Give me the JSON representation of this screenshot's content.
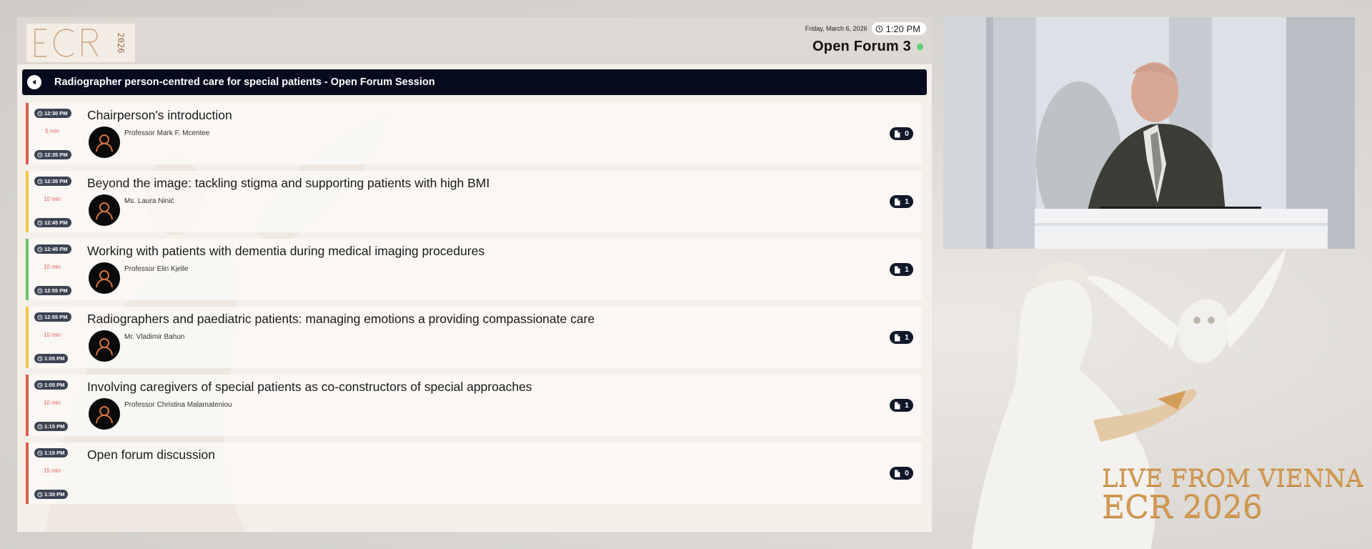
{
  "header": {
    "logo_text": "ECR 2026",
    "date": "Friday, March 6, 2026",
    "time": "1:20 PM",
    "room": "Open Forum 3"
  },
  "session": {
    "title": "Radiographer person-centred care for special patients - Open Forum Session"
  },
  "talks": [
    {
      "start": "12:30 PM",
      "duration": "5 min",
      "end": "12:35 PM",
      "title": "Chairperson's introduction",
      "speaker": "Professor Mark F. Mcentee",
      "docs": "0",
      "accent": "#e05a4f",
      "has_speaker": true
    },
    {
      "start": "12:35 PM",
      "duration": "10 min",
      "end": "12:45 PM",
      "title": "Beyond the image: tackling stigma and supporting patients with high BMI",
      "speaker": "Ms. Laura Ninić",
      "docs": "1",
      "accent": "#f1c644",
      "has_speaker": true
    },
    {
      "start": "12:45 PM",
      "duration": "10 min",
      "end": "12:55 PM",
      "title": "Working with patients with dementia during medical imaging procedures",
      "speaker": "Professor Elin Kjelle",
      "docs": "1",
      "accent": "#6cc36c",
      "has_speaker": true
    },
    {
      "start": "12:55 PM",
      "duration": "10 min",
      "end": "1:05 PM",
      "title": "Radiographers and paediatric patients: managing emotions a providing compassionate care",
      "speaker": "Mr. Vladimir Bahun",
      "docs": "1",
      "accent": "#f1c644",
      "has_speaker": true
    },
    {
      "start": "1:05 PM",
      "duration": "10 min",
      "end": "1:15 PM",
      "title": "Involving caregivers of special patients as co-constructors of special approaches",
      "speaker": "Professor Christina Malamateniou",
      "docs": "1",
      "accent": "#e05a4f",
      "has_speaker": true
    },
    {
      "start": "1:15 PM",
      "duration": "15 min",
      "end": "1:30 PM",
      "title": "Open forum discussion",
      "speaker": "",
      "docs": "0",
      "accent": "#e05a4f",
      "has_speaker": false
    }
  ],
  "branding": {
    "line1": "LIVE FROM VIENNA",
    "line2": "ECR 2026"
  },
  "colors": {
    "session_bar": "#050b1c",
    "badge": "#3c4453",
    "doc_badge": "#11182a",
    "live": "#5fd07a",
    "gold": "#d29a52"
  }
}
